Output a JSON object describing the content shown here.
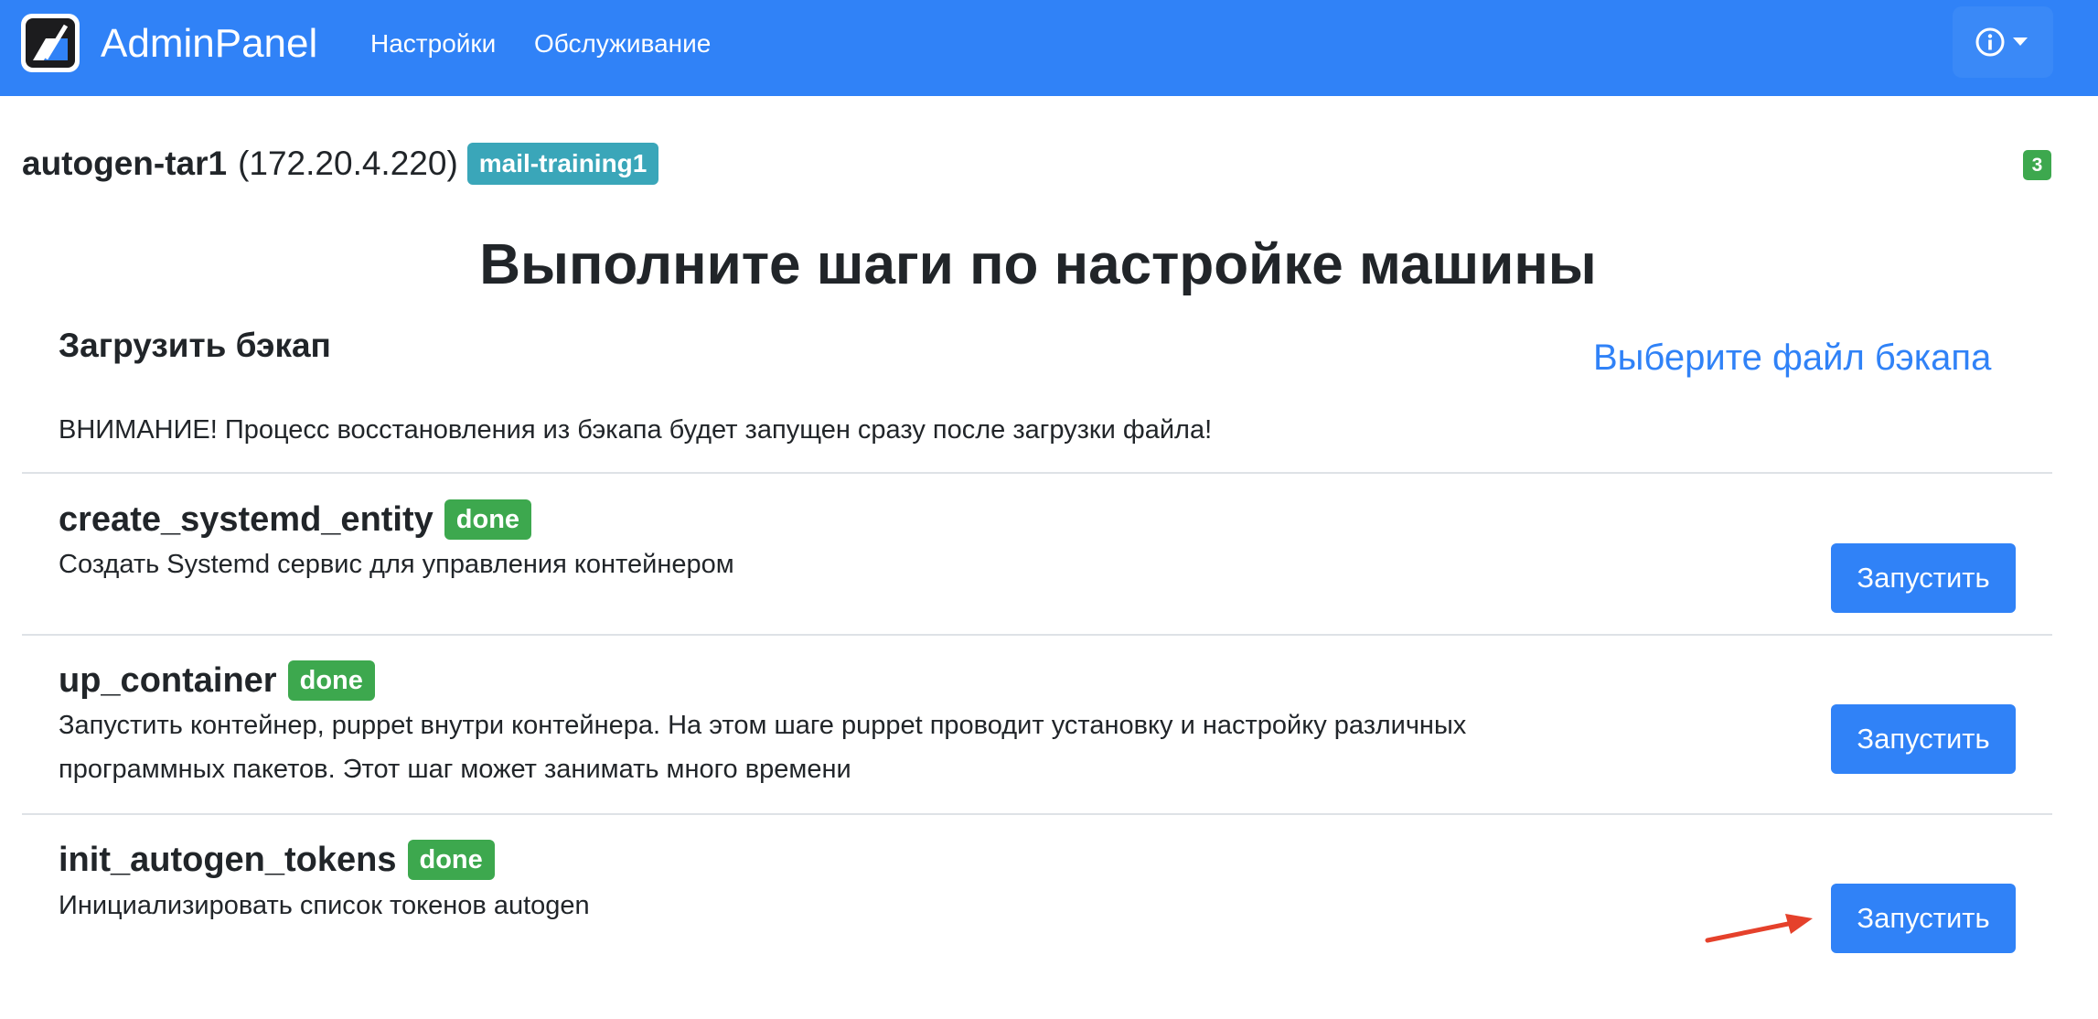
{
  "navbar": {
    "brand": "AdminPanel",
    "links": [
      "Настройки",
      "Обслуживание"
    ],
    "icons": {
      "logo": "adminpanel-logo",
      "info": "info-circle-icon",
      "caret": "caret-down-icon"
    }
  },
  "host": {
    "name": "autogen-tar1",
    "ip": "(172.20.4.220)",
    "tag": "mail-training1",
    "count": "3"
  },
  "page_title": "Выполните шаги по настройке машины",
  "backup": {
    "title": "Загрузить бэкап",
    "link": "Выберите файл бэкапа",
    "warning": "ВНИМАНИЕ! Процесс восстановления из бэкапа будет запущен сразу после загрузки файла!"
  },
  "steps": [
    {
      "name": "create_systemd_entity",
      "status": "done",
      "description": [
        "Создать Systemd сервис для управления контейнером"
      ],
      "button": "Запустить"
    },
    {
      "name": "up_container",
      "status": "done",
      "description": [
        "Запустить контейнер, puppet внутри контейнера. На этом шаге puppet проводит установку и настройку различных",
        "программных пакетов. Этот шаг может занимать много времени"
      ],
      "button": "Запустить"
    },
    {
      "name": "init_autogen_tokens",
      "status": "done",
      "description": [
        "Инициализировать список токенов autogen"
      ],
      "button": "Запустить"
    }
  ],
  "colors": {
    "navbar": "#3082f7",
    "tag": "#3aa6b9",
    "success": "#3da84e",
    "primary": "#3082f7",
    "annotation_arrow": "#e5412b"
  }
}
